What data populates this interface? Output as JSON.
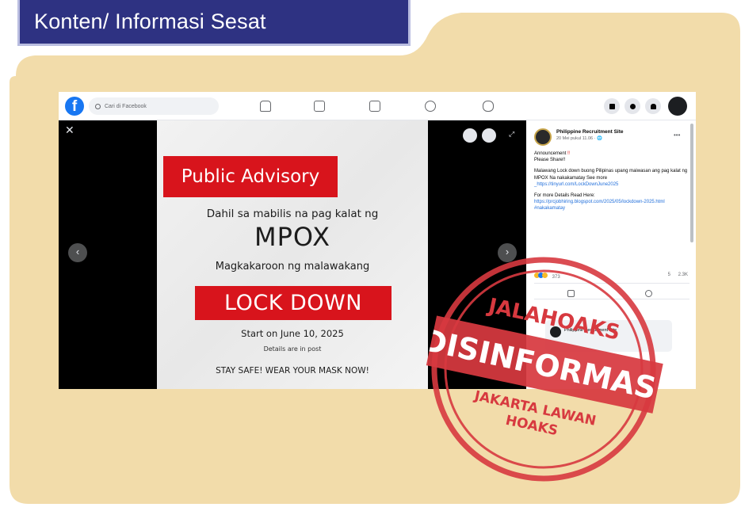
{
  "header": {
    "title": "Konten/ Informasi Sesat"
  },
  "facebook": {
    "logo_glyph": "f",
    "search_placeholder": "Cari di Facebook",
    "nav_icons": [
      "home-icon",
      "video-icon",
      "marketplace-icon",
      "groups-icon",
      "gaming-icon"
    ],
    "right_icons": [
      "menu-grid-icon",
      "messenger-icon",
      "notifications-icon",
      "profile-avatar"
    ],
    "close_glyph": "✕",
    "prev_glyph": "‹",
    "next_glyph": "›",
    "expand_glyph": "⤢"
  },
  "poster": {
    "headline": "Public Advisory",
    "line1": "Dahil sa mabilis na pag kalat ng",
    "disease": "MPOX",
    "line2": "Magkakaroon ng malawakang",
    "banner": "LOCK DOWN",
    "start_date": "Start on June 10, 2025",
    "details_note": "Details are in post",
    "footer": "STAY SAFE! WEAR YOUR MASK NOW!"
  },
  "post": {
    "page_name": "Philippine Recruitment Site",
    "timestamp": "20 Mei pukul 11.06 · 🌐",
    "announcement": "Announcement",
    "announcement_mark": "‼",
    "please_share": "Please Share!!",
    "body": "Malawang Lock down buong Pilipinas upang maiwasan ang pag kalat ng MPOX Na nakakamatay See more",
    "body_link": "_https://tinyurl.com/LockDownJune2025",
    "more_details_label": "For more Details Read Here:",
    "more_details_link": "https://prcjobhiring.blogspot.com/2025/05/lockdown-2025.html",
    "tag": "#nakakamatay",
    "reaction_count": "373",
    "comment_count": "5",
    "share_count": "2.3K",
    "preview_text": "Philippine Recruitment Site"
  },
  "stamp": {
    "top_text": "JALAHOAKS",
    "main_text": "DISINFORMASI",
    "bottom_line1": "JAKARTA LAWAN",
    "bottom_line2": "HOAKS",
    "color": "#d7393f"
  },
  "colors": {
    "folder_bg": "#f2dcaa",
    "tab_bg": "#2e3282",
    "facebook_blue": "#1877f2",
    "poster_red": "#d8141c"
  }
}
